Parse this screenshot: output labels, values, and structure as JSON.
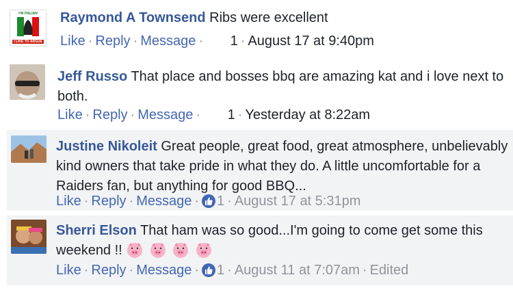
{
  "comments": [
    {
      "author": "Raymond A Townsend",
      "text": "Ribs were excellent",
      "avatar_text_top": "I'M ITALIAN",
      "avatar_text_bottom": "I LIKE TO ARGUE",
      "actions": {
        "like": "Like",
        "reply": "Reply",
        "message": "Message"
      },
      "like_count": "1",
      "timestamp": "August 17 at 9:40pm"
    },
    {
      "author": "Jeff Russo",
      "text": "That place and bosses bbq are amazing kat and i love next to both.",
      "actions": {
        "like": "Like",
        "reply": "Reply",
        "message": "Message"
      },
      "like_count": "1",
      "timestamp": "Yesterday at 8:22am"
    },
    {
      "author": "Justine Nikoleit",
      "text": "Great people, great food, great atmosphere, unbelievably kind owners that take pride in what they do. A little uncomfortable for a Raiders fan, but anything for good BBQ...",
      "actions": {
        "like": "Like",
        "reply": "Reply",
        "message": "Message"
      },
      "like_count": "1",
      "timestamp": "August 17 at 5:31pm"
    },
    {
      "author": "Sherri Elson",
      "text": "That ham was so good...I'm going to come get some this weekend !!",
      "actions": {
        "like": "Like",
        "reply": "Reply",
        "message": "Message"
      },
      "like_count": "1",
      "timestamp": "August 11 at 7:07am",
      "edited": "Edited"
    }
  ],
  "colors": {
    "link": "#4267b2",
    "name": "#365899",
    "meta": "#90949c",
    "highlight_bg": "#f2f3f5"
  },
  "icons": [
    "like-thumb-icon",
    "pig-face-icon"
  ]
}
